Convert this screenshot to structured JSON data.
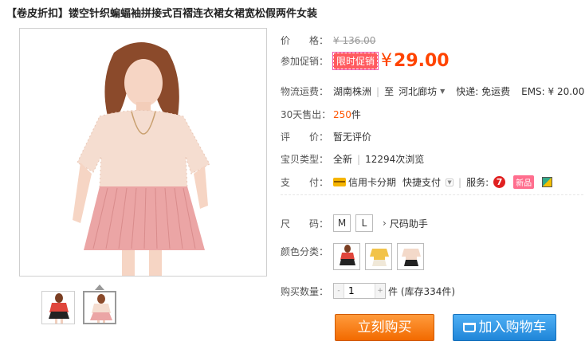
{
  "product": {
    "title": "【卷皮折扣】镂空针织蝙蝠袖拼接式百褶连衣裙女裙宽松假两件女装"
  },
  "pricing": {
    "label_price": "价　　格：",
    "original_price": "¥ 136.00",
    "label_promo": "参加促销：",
    "promo_badge": "限时促销",
    "yen_sign": "¥",
    "promo_price": "29.00"
  },
  "shipping": {
    "label": "物流运费：",
    "from": "湖南株洲",
    "to_prefix": "至",
    "to": "河北廊坊",
    "express": "快递: 免运费",
    "ems": "EMS: ¥ 20.00"
  },
  "sales": {
    "label": "30天售出：",
    "count": "250",
    "unit": "件"
  },
  "review": {
    "label": "评　　价：",
    "value": "暂无评价"
  },
  "item_type": {
    "label": "宝贝类型：",
    "condition": "全新",
    "views": "12294次浏览"
  },
  "payment": {
    "label": "支　　付：",
    "installment": "信用卡分期",
    "quick_pay": "快捷支付",
    "services_label": "服务:",
    "new_badge": "新品"
  },
  "size": {
    "label": "尺　　码：",
    "options": [
      "M",
      "L"
    ],
    "helper": "尺码助手"
  },
  "color": {
    "label": "颜色分类："
  },
  "quantity": {
    "label": "购买数量：",
    "value": "1",
    "minus": "-",
    "plus": "+",
    "stock": "件 (库存334件)"
  },
  "actions": {
    "buy_now": "立刻购买",
    "add_to_cart": "加入购物车"
  },
  "colors": {
    "price_accent": "#ff4400",
    "buy_button": "#f26a00",
    "cart_button": "#1f85d8"
  }
}
